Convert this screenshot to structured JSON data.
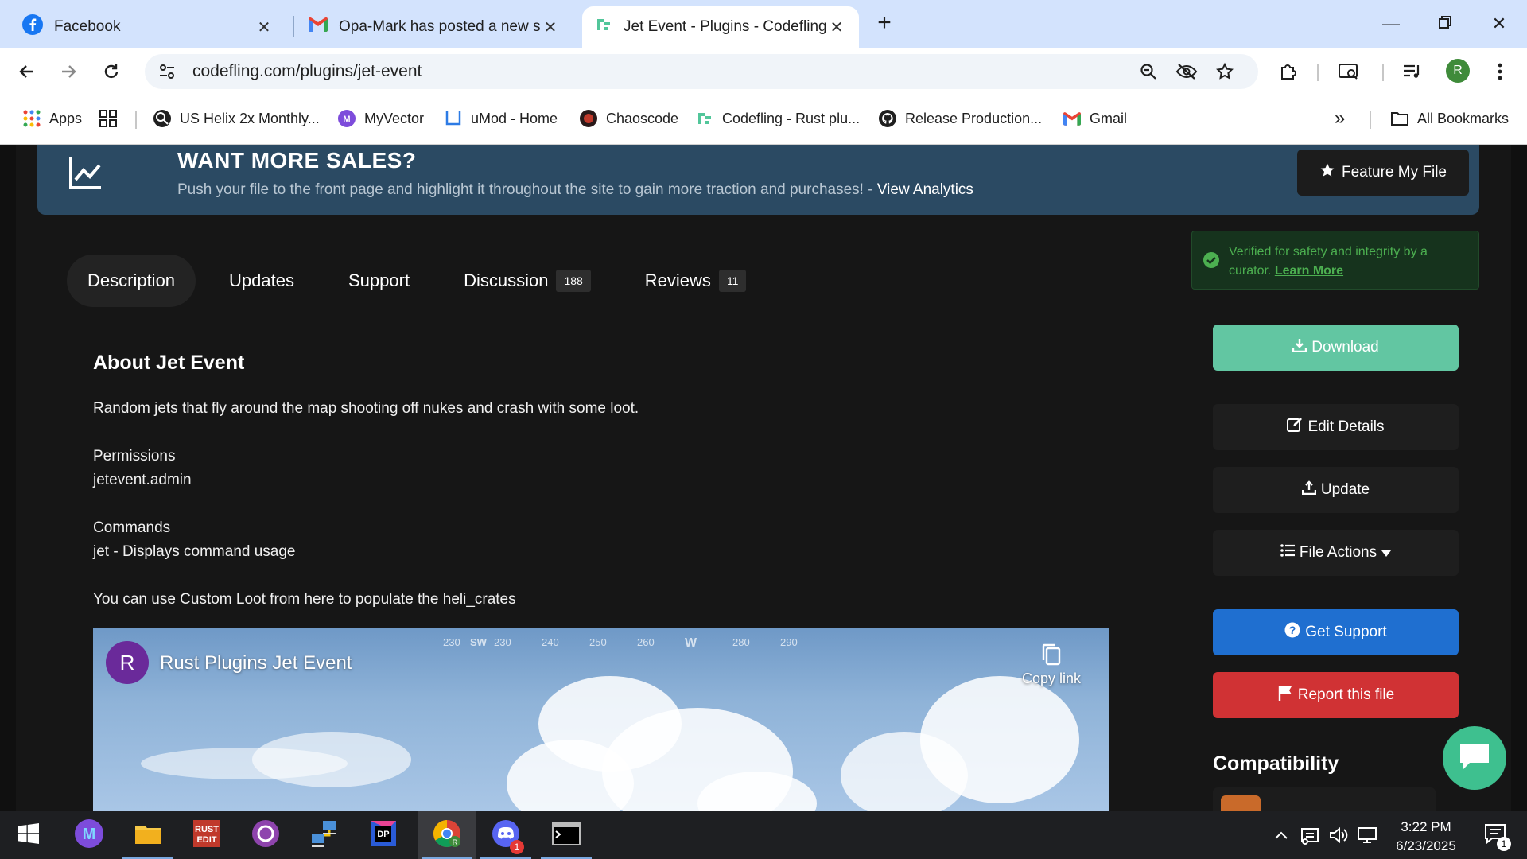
{
  "browser": {
    "tabs": [
      {
        "title": "Facebook",
        "active": false
      },
      {
        "title": "Opa-Mark has posted a new su",
        "active": false
      },
      {
        "title": "Jet Event - Plugins - Codefling",
        "active": true
      }
    ],
    "url": "codefling.com/plugins/jet-event",
    "bookmarks": [
      {
        "label": "Apps"
      },
      {
        "label": "US Helix 2x Monthly..."
      },
      {
        "label": "MyVector"
      },
      {
        "label": "uMod - Home"
      },
      {
        "label": "Chaoscode"
      },
      {
        "label": "Codefling - Rust plu..."
      },
      {
        "label": "Release Production..."
      },
      {
        "label": "Gmail"
      }
    ],
    "all_bookmarks": "All Bookmarks",
    "more_chevron": "»",
    "profile_initial": "R"
  },
  "promo": {
    "title": "WANT MORE SALES?",
    "text": "Push your file to the front page and highlight it throughout the site to gain more traction and purchases! - ",
    "link": "View Analytics",
    "button": "Feature My File"
  },
  "tabs": [
    {
      "label": "Description",
      "badge": null
    },
    {
      "label": "Updates",
      "badge": null
    },
    {
      "label": "Support",
      "badge": null
    },
    {
      "label": "Discussion",
      "badge": "188"
    },
    {
      "label": "Reviews",
      "badge": "11"
    }
  ],
  "content": {
    "heading": "About Jet Event",
    "intro": "Random jets that fly around the map shooting off nukes and crash with some loot.",
    "permissions_title": "Permissions",
    "permissions_value": "jetevent.admin",
    "commands_title": "Commands",
    "commands_value": "jet - Displays command usage",
    "custom_loot": "You can use Custom Loot from here to populate the heli_crates"
  },
  "video": {
    "avatar": "R",
    "title": "Rust Plugins Jet Event",
    "copy_link": "Copy link",
    "compass": [
      "230",
      "SW",
      "230",
      "240",
      "250",
      "260",
      "W",
      "280",
      "290"
    ]
  },
  "sidebar": {
    "verified_text": "Verified for safety and integrity by a curator. ",
    "verified_link": "Learn More",
    "download": "Download",
    "edit": "Edit Details",
    "update": "Update",
    "file_actions": "File Actions",
    "get_support": "Get Support",
    "report": "Report this file",
    "compatibility": "Compatibility"
  },
  "taskbar": {
    "time": "3:22 PM",
    "date": "6/23/2025",
    "notification_count": "1",
    "discord_badge": "1"
  },
  "colors": {
    "promo_bg": "#2b4a63",
    "download": "#62c6a2",
    "support": "#1f6fd0",
    "report": "#d03234",
    "verified": "#4caf50",
    "accent": "#3ec08f"
  }
}
